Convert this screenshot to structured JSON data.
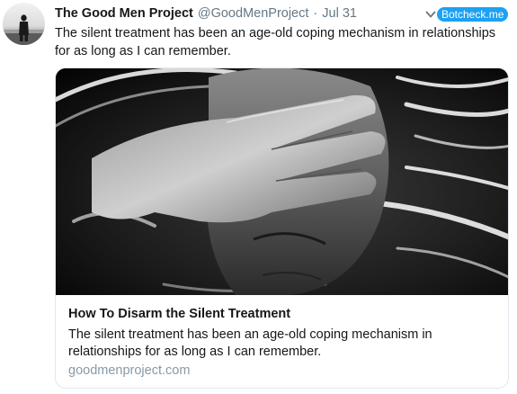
{
  "tweet": {
    "author_name": "The Good Men Project",
    "author_handle": "@GoodMenProject",
    "separator": "·",
    "date": "Jul 31",
    "text": "The silent treatment has been an age-old coping mechanism in relationships for as long as I can remember."
  },
  "botcheck": {
    "label": "Botcheck.me",
    "accent_color": "#1da1f2",
    "icon": "chevron-down-icon"
  },
  "card": {
    "title": "How To Disarm the Silent Treatment",
    "description": "The silent treatment has been an age-old coping mechanism in relationships for as long as I can remember.",
    "domain": "goodmenproject.com"
  },
  "colors": {
    "text": "#14171a",
    "muted": "#657786",
    "domain": "#8899a6",
    "border": "#e1e8ed"
  }
}
